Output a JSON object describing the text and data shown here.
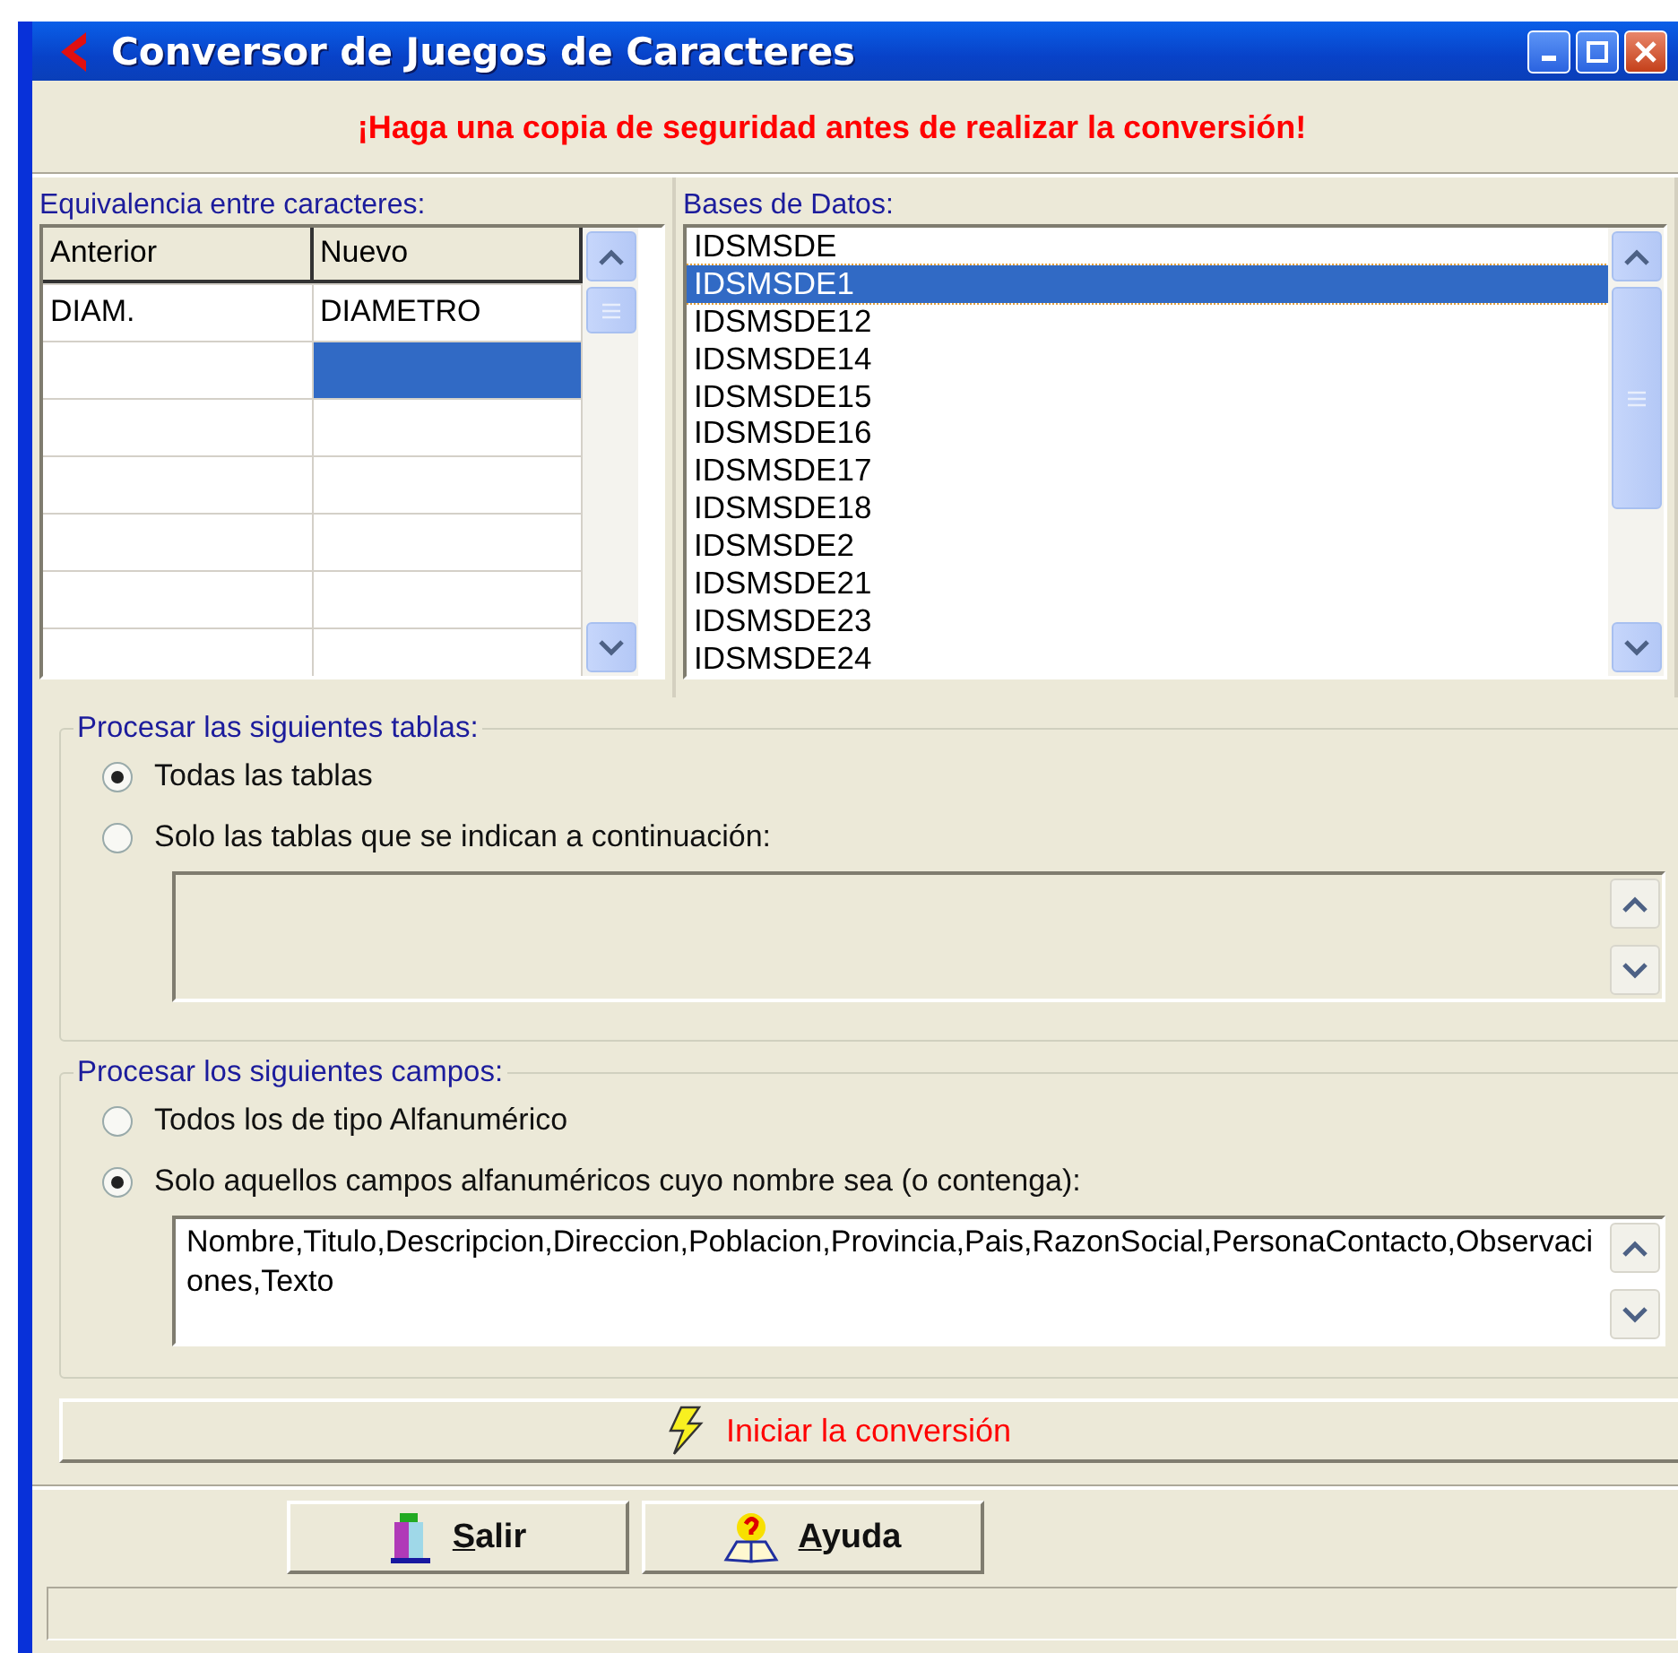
{
  "window": {
    "title": "Conversor de Juegos de Caracteres"
  },
  "warning": "¡Haga una copia de seguridad antes de realizar la conversión!",
  "equivalences": {
    "label": "Equivalencia entre caracteres:",
    "columns": [
      "Anterior",
      "Nuevo"
    ],
    "rows": [
      {
        "cells": [
          {
            "text": "DIAM.",
            "selected": false
          },
          {
            "text": "DIAMETRO",
            "selected": false
          }
        ]
      },
      {
        "cells": [
          {
            "selected": false
          },
          {
            "selected": true
          }
        ]
      },
      {
        "cells": [
          {
            "selected": false
          },
          {
            "selected": false
          }
        ]
      },
      {
        "cells": [
          {
            "selected": false
          },
          {
            "selected": false
          }
        ]
      },
      {
        "cells": [
          {
            "selected": false
          },
          {
            "selected": false
          }
        ]
      },
      {
        "cells": [
          {
            "selected": false
          },
          {
            "selected": false
          }
        ]
      },
      {
        "cells": [
          {
            "selected": false
          },
          {
            "selected": false
          }
        ]
      }
    ]
  },
  "databases": {
    "label": "Bases de Datos:",
    "items": [
      {
        "name": "IDSMSDE",
        "selected": false
      },
      {
        "name": "IDSMSDE1",
        "selected": true
      },
      {
        "name": "IDSMSDE12",
        "selected": false
      },
      {
        "name": "IDSMSDE14",
        "selected": false
      },
      {
        "name": "IDSMSDE15",
        "selected": false
      },
      {
        "name": "IDSMSDE16",
        "selected": false
      },
      {
        "name": "IDSMSDE17",
        "selected": false
      },
      {
        "name": "IDSMSDE18",
        "selected": false
      },
      {
        "name": "IDSMSDE2",
        "selected": false
      },
      {
        "name": "IDSMSDE21",
        "selected": false
      },
      {
        "name": "IDSMSDE23",
        "selected": false
      },
      {
        "name": "IDSMSDE24",
        "selected": false
      }
    ]
  },
  "tables_group": {
    "legend": "Procesar las siguientes tablas:",
    "options": [
      {
        "label": "Todas las tablas",
        "selected": true
      },
      {
        "label": "Solo las tablas que se indican a continuación:",
        "selected": false
      }
    ],
    "table_list": {
      "disabled": true
    }
  },
  "fields_group": {
    "legend": "Procesar los siguientes campos:",
    "options": [
      {
        "label": "Todos los de tipo Alfanumérico",
        "selected": false
      },
      {
        "label": "Solo aquellos campos alfanuméricos cuyo nombre sea (o contenga):",
        "selected": true
      }
    ],
    "field_list": {
      "disabled": false,
      "value": "Nombre,Titulo,Descripcion,Direccion,Poblacion,Provincia,Pais,RazonSocial,PersonaContacto,Observaciones,Texto"
    }
  },
  "start_button": {
    "label": "Iniciar la conversión"
  },
  "buttons": [
    {
      "label": "Salir",
      "kind": "exit",
      "mnemonic_first": true
    },
    {
      "label": "Ayuda",
      "kind": "help",
      "mnemonic_first": true
    }
  ]
}
